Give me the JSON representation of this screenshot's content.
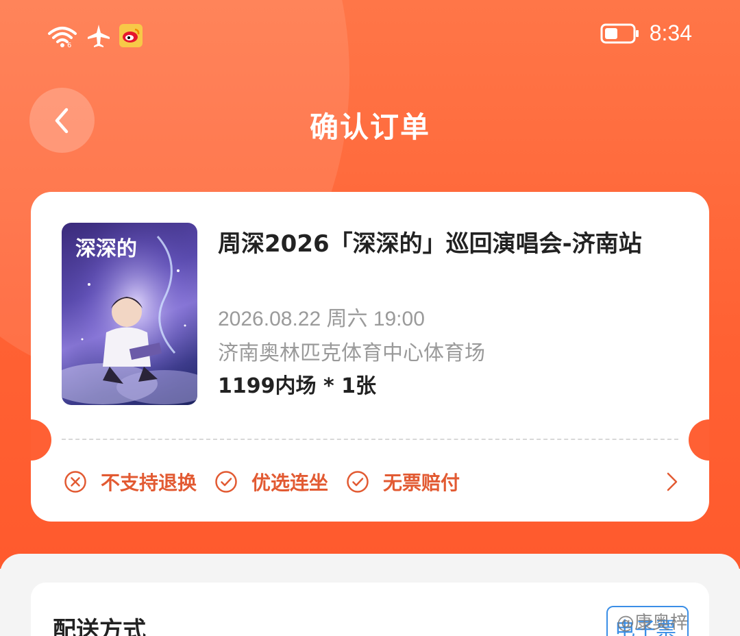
{
  "status_bar": {
    "time": "8:34",
    "icons": [
      "wifi-icon",
      "airplane-icon",
      "weibo-icon",
      "battery-icon"
    ]
  },
  "nav": {
    "title": "确认订单",
    "back_icon": "chevron-left-icon"
  },
  "order": {
    "title": "周深2026「深深的」巡回演唱会-济南站",
    "datetime": "2026.08.22 周六 19:00",
    "venue": "济南奥林匹克体育中心体育场",
    "ticket": "1199内场 * 1张",
    "poster_text": "深深的",
    "policies": [
      {
        "label": "不支持退换",
        "icon": "circle-x-icon"
      },
      {
        "label": "优选连坐",
        "icon": "circle-check-icon"
      },
      {
        "label": "无票赔付",
        "icon": "circle-check-icon"
      }
    ]
  },
  "delivery": {
    "title": "配送方式",
    "badge": "电子票"
  },
  "watermark": "@康奥梓",
  "colors": {
    "header_orange": "#ff6a3a",
    "policy_text": "#e25a32",
    "badge_blue": "#3a8ee6"
  }
}
